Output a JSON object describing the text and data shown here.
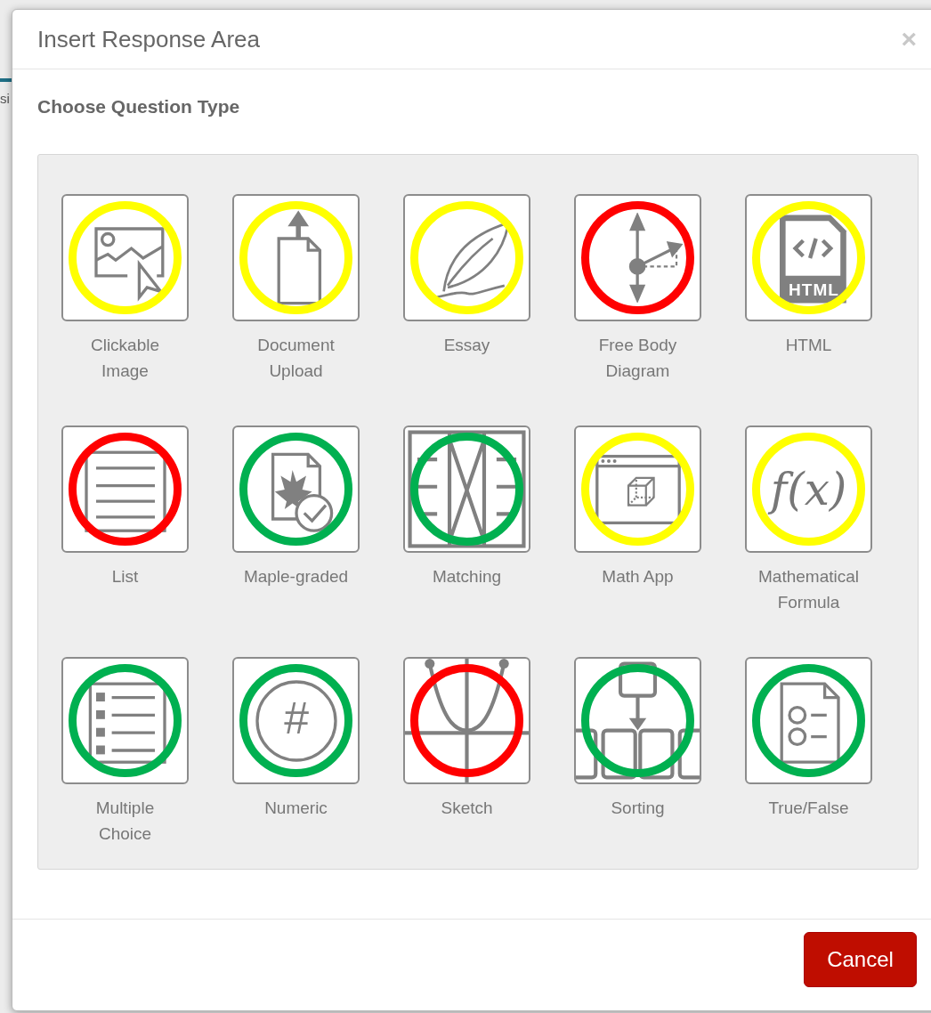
{
  "background": {
    "text": "si"
  },
  "dialog": {
    "title": "Insert Response Area",
    "close": "×",
    "heading": "Choose Question Type",
    "items": [
      {
        "label": "Clickable Image",
        "kind": "image",
        "color": "#ffff00"
      },
      {
        "label": "Document Upload",
        "kind": "upload",
        "color": "#ffff00"
      },
      {
        "label": "Essay",
        "kind": "quill",
        "color": "#ffff00"
      },
      {
        "label": "Free Body Diagram",
        "kind": "vectors",
        "color": "#ff0000"
      },
      {
        "label": "HTML",
        "kind": "html",
        "color": "#ffff00",
        "icon_text": "HTML"
      },
      {
        "label": "List",
        "kind": "list",
        "color": "#ff0000"
      },
      {
        "label": "Maple-graded",
        "kind": "leaf",
        "color": "#00b050"
      },
      {
        "label": "Matching",
        "kind": "matching",
        "color": "#00b050"
      },
      {
        "label": "Math App",
        "kind": "cube",
        "color": "#ffff00"
      },
      {
        "label": "Mathematical Formula",
        "kind": "formula",
        "color": "#ffff00",
        "icon_text": "f(x)"
      },
      {
        "label": "Multiple Choice",
        "kind": "choices",
        "color": "#00b050"
      },
      {
        "label": "Numeric",
        "kind": "numeric",
        "color": "#00b050",
        "icon_text": "#"
      },
      {
        "label": "Sketch",
        "kind": "graph",
        "color": "#ff0000"
      },
      {
        "label": "Sorting",
        "kind": "sorting",
        "color": "#00b050"
      },
      {
        "label": "True/False",
        "kind": "truefalse",
        "color": "#00b050"
      }
    ],
    "buttons": [
      {
        "label": "Cancel"
      }
    ]
  }
}
